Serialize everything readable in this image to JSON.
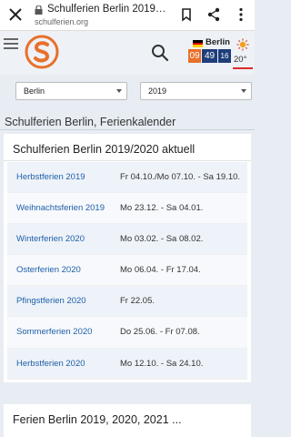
{
  "browser": {
    "page_title": "Schulferien Berlin 2019, ...",
    "url": "schulferien.org",
    "icons": [
      "close-icon",
      "lock-icon",
      "bookmark-icon",
      "share-icon",
      "more-icon"
    ]
  },
  "header": {
    "countdown": {
      "city": "Berlin",
      "days": "09",
      "hours": "49",
      "minutes": "16"
    },
    "weather": {
      "temperature": "20°",
      "icon": "sun-icon"
    },
    "accent_colors": {
      "orange": "#e8702a",
      "navy": "#1e3e7a",
      "link": "#1f5fa8"
    }
  },
  "filters": {
    "state": "Berlin",
    "year": "2019"
  },
  "main": {
    "heading": "Schulferien Berlin, Ferienkalender",
    "card": {
      "title": "Schulferien Berlin 2019/2020 aktuell",
      "rows": [
        {
          "name": "Herbstferien 2019",
          "dates": "Fr 04.10./Mo 07.10. - Sa 19.10."
        },
        {
          "name": "Weihnachtsferien 2019",
          "dates": "Mo 23.12. - Sa 04.01."
        },
        {
          "name": "Winterferien 2020",
          "dates": "Mo 03.02. - Sa 08.02."
        },
        {
          "name": "Osterferien 2020",
          "dates": "Mo 06.04. - Fr 17.04."
        },
        {
          "name": "Pfingstferien 2020",
          "dates": "Fr 22.05."
        },
        {
          "name": "Sommerferien 2020",
          "dates": "Do 25.06. - Fr 07.08."
        },
        {
          "name": "Herbstferien 2020",
          "dates": "Mo 12.10. - Sa 24.10."
        }
      ]
    },
    "card2_title": "Ferien Berlin 2019, 2020, 2021 ..."
  }
}
